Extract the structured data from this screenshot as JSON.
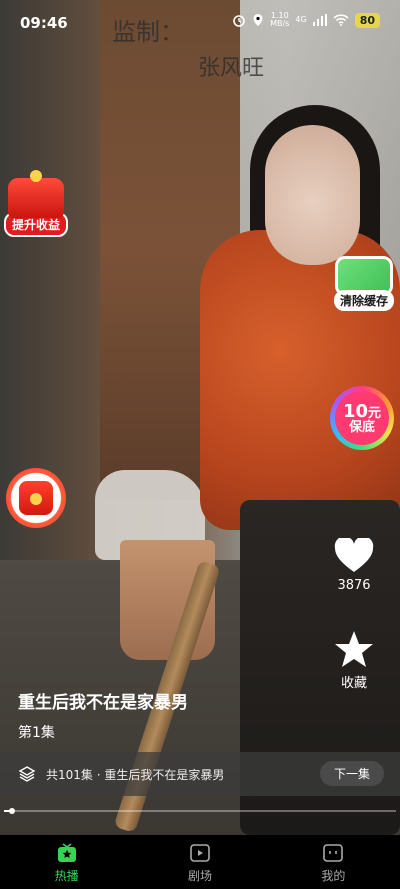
{
  "status_bar": {
    "time": "09:46",
    "network_speed_value": "1.10",
    "network_speed_unit": "MB/s",
    "signal_type": "4G",
    "battery": "80"
  },
  "video": {
    "watermark_1": "监制：",
    "watermark_2": "张风旺"
  },
  "widgets": {
    "boost_label": "提升收益",
    "clean_cache_label": "清除缓存",
    "guarantee_amount": "10",
    "guarantee_unit": "元",
    "guarantee_label": "保底"
  },
  "actions": {
    "like_count": "3876",
    "favorite_label": "收藏"
  },
  "drama": {
    "title": "重生后我不在是家暴男",
    "episode": "第1集",
    "series_info": "共101集 · 重生后我不在是家暴男",
    "next_button": "下一集"
  },
  "playback": {
    "progress": 0.02
  },
  "tabs": [
    {
      "label": "热播",
      "icon": "star-tv-icon",
      "active": true
    },
    {
      "label": "剧场",
      "icon": "play-screen-icon",
      "active": false
    },
    {
      "label": "我的",
      "icon": "profile-tv-icon",
      "active": false
    }
  ],
  "colors": {
    "accent": "#39d353",
    "battery": "#e6d64a",
    "boost_red": "#e21c1c"
  }
}
